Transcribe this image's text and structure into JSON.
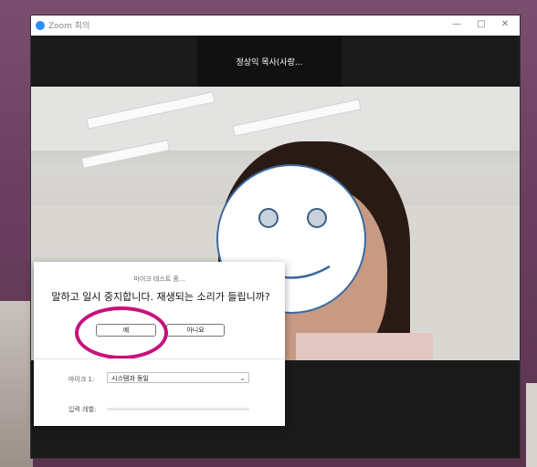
{
  "window": {
    "title": "Zoom 회의"
  },
  "participant": {
    "name": "정상익 목사(사랑..."
  },
  "dialog": {
    "title": "마이크 테스트 중...",
    "question": "말하고 일시 중지합니다. 재생되는 소리가 들립니까?",
    "yes_label": "예",
    "no_label": "아니요",
    "mic_label": "마이크 1:",
    "mic_value": "시스템과 동일",
    "input_level_label": "입력 레벨:",
    "input_level": 0
  },
  "colors": {
    "highlight": "#c8107c",
    "zoom_blue": "#2d8cff"
  }
}
